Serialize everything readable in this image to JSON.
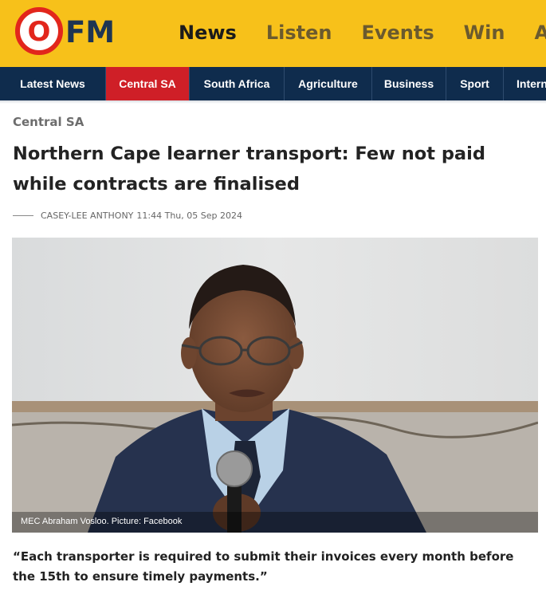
{
  "brand": {
    "logo_text": "FM",
    "logo_letter": "O",
    "primary_color": "#f7c11a",
    "nav_color": "#0f2c4d",
    "accent_red": "#cf1f27"
  },
  "main_nav": [
    {
      "label": "News",
      "active": true
    },
    {
      "label": "Listen",
      "active": false
    },
    {
      "label": "Events",
      "active": false
    },
    {
      "label": "Win",
      "active": false
    },
    {
      "label": "Adv",
      "active": false
    }
  ],
  "category_nav": [
    {
      "label": "Latest News",
      "active": false
    },
    {
      "label": "Central SA",
      "active": true
    },
    {
      "label": "South Africa",
      "active": false
    },
    {
      "label": "Agriculture",
      "active": false
    },
    {
      "label": "Business",
      "active": false
    },
    {
      "label": "Sport",
      "active": false
    },
    {
      "label": "Intern",
      "active": false
    }
  ],
  "article": {
    "section": "Central SA",
    "headline": "Northern Cape learner transport: Few not paid while contracts are finalised",
    "author": "CASEY-LEE ANTHONY",
    "datetime": "11:44 Thu, 05 Sep 2024",
    "image_caption": "MEC Abraham Vosloo. Picture: Facebook",
    "lead_quote": "“Each transporter is required to submit their invoices every month before the 15th to ensure timely payments.”"
  }
}
